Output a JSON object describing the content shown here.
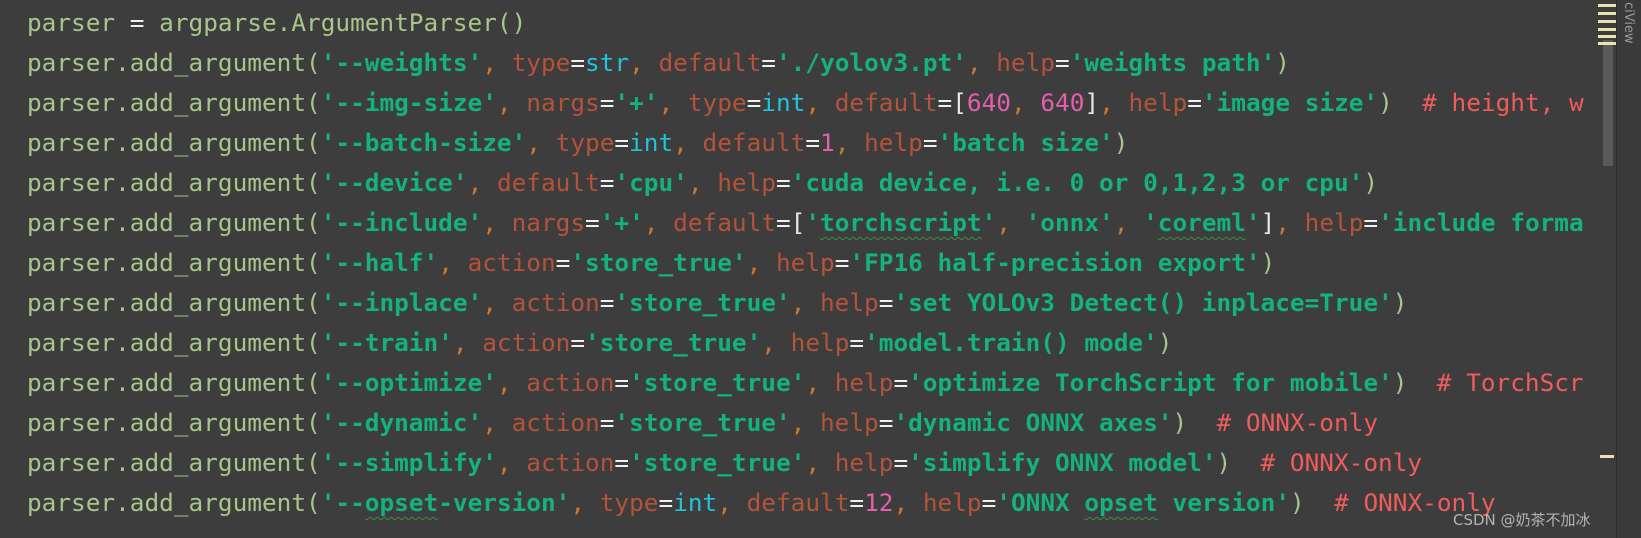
{
  "colors": {
    "background": "#3d3d3d",
    "default": "#a8c68a",
    "string": "#13b27f",
    "keyword_arg": "#b5533a",
    "builtin": "#22c3dc",
    "number": "#e35fb0",
    "comment": "#f05c5c"
  },
  "side_panel": {
    "label": "ciView"
  },
  "watermark": "CSDN @奶茶不加冰",
  "code_lines": [
    [
      [
        "def",
        "parser "
      ],
      [
        "eq",
        "="
      ],
      [
        "def",
        " argparse.ArgumentParser()"
      ]
    ],
    [
      [
        "def",
        "parser.add_argument("
      ],
      [
        "str",
        "'--weights'"
      ],
      [
        "com",
        ", "
      ],
      [
        "kw",
        "type"
      ],
      [
        "eq",
        "="
      ],
      [
        "bi",
        "str"
      ],
      [
        "com",
        ", "
      ],
      [
        "kw",
        "default"
      ],
      [
        "eq",
        "="
      ],
      [
        "str",
        "'./yolov3.pt'"
      ],
      [
        "com",
        ", "
      ],
      [
        "kw",
        "help"
      ],
      [
        "eq",
        "="
      ],
      [
        "str",
        "'weights path'"
      ],
      [
        "def",
        ")"
      ]
    ],
    [
      [
        "def",
        "parser.add_argument("
      ],
      [
        "str",
        "'--img-size'"
      ],
      [
        "com",
        ", "
      ],
      [
        "kw",
        "nargs"
      ],
      [
        "eq",
        "="
      ],
      [
        "str",
        "'+'"
      ],
      [
        "com",
        ", "
      ],
      [
        "kw",
        "type"
      ],
      [
        "eq",
        "="
      ],
      [
        "bi",
        "int"
      ],
      [
        "com",
        ", "
      ],
      [
        "kw",
        "default"
      ],
      [
        "eq",
        "="
      ],
      [
        "brk",
        "["
      ],
      [
        "num",
        "640"
      ],
      [
        "com",
        ", "
      ],
      [
        "num",
        "640"
      ],
      [
        "brk",
        "]"
      ],
      [
        "com",
        ", "
      ],
      [
        "kw",
        "help"
      ],
      [
        "eq",
        "="
      ],
      [
        "str",
        "'image size'"
      ],
      [
        "def",
        ")"
      ],
      [
        "cmt",
        "  # height, w"
      ]
    ],
    [
      [
        "def",
        "parser.add_argument("
      ],
      [
        "str",
        "'--batch-size'"
      ],
      [
        "com",
        ", "
      ],
      [
        "kw",
        "type"
      ],
      [
        "eq",
        "="
      ],
      [
        "bi",
        "int"
      ],
      [
        "com",
        ", "
      ],
      [
        "kw",
        "default"
      ],
      [
        "eq",
        "="
      ],
      [
        "num",
        "1"
      ],
      [
        "com",
        ", "
      ],
      [
        "kw",
        "help"
      ],
      [
        "eq",
        "="
      ],
      [
        "str",
        "'batch size'"
      ],
      [
        "def",
        ")"
      ]
    ],
    [
      [
        "def",
        "parser.add_argument("
      ],
      [
        "str",
        "'--device'"
      ],
      [
        "com",
        ", "
      ],
      [
        "kw",
        "default"
      ],
      [
        "eq",
        "="
      ],
      [
        "str",
        "'cpu'"
      ],
      [
        "com",
        ", "
      ],
      [
        "kw",
        "help"
      ],
      [
        "eq",
        "="
      ],
      [
        "str",
        "'cuda device, i.e. 0 or 0,1,2,3 or cpu'"
      ],
      [
        "def",
        ")"
      ]
    ],
    [
      [
        "def",
        "parser.add_argument("
      ],
      [
        "str",
        "'--include'"
      ],
      [
        "com",
        ", "
      ],
      [
        "kw",
        "nargs"
      ],
      [
        "eq",
        "="
      ],
      [
        "str",
        "'+'"
      ],
      [
        "com",
        ", "
      ],
      [
        "kw",
        "default"
      ],
      [
        "eq",
        "="
      ],
      [
        "brk",
        "["
      ],
      [
        "str",
        "'"
      ],
      [
        "sq",
        "torchscript"
      ],
      [
        "str",
        "'"
      ],
      [
        "com",
        ", "
      ],
      [
        "str",
        "'onnx'"
      ],
      [
        "com",
        ", "
      ],
      [
        "str",
        "'"
      ],
      [
        "sq",
        "coreml"
      ],
      [
        "str",
        "'"
      ],
      [
        "brk",
        "]"
      ],
      [
        "com",
        ", "
      ],
      [
        "kw",
        "help"
      ],
      [
        "eq",
        "="
      ],
      [
        "str",
        "'include forma"
      ]
    ],
    [
      [
        "def",
        "parser.add_argument("
      ],
      [
        "str",
        "'--half'"
      ],
      [
        "com",
        ", "
      ],
      [
        "kw",
        "action"
      ],
      [
        "eq",
        "="
      ],
      [
        "str",
        "'store_true'"
      ],
      [
        "com",
        ", "
      ],
      [
        "kw",
        "help"
      ],
      [
        "eq",
        "="
      ],
      [
        "str",
        "'FP16 half-precision export'"
      ],
      [
        "def",
        ")"
      ]
    ],
    [
      [
        "def",
        "parser.add_argument("
      ],
      [
        "str",
        "'--inplace'"
      ],
      [
        "com",
        ", "
      ],
      [
        "kw",
        "action"
      ],
      [
        "eq",
        "="
      ],
      [
        "str",
        "'store_true'"
      ],
      [
        "com",
        ", "
      ],
      [
        "kw",
        "help"
      ],
      [
        "eq",
        "="
      ],
      [
        "str",
        "'set YOLOv3 Detect() inplace=True'"
      ],
      [
        "def",
        ")"
      ]
    ],
    [
      [
        "def",
        "parser.add_argument("
      ],
      [
        "str",
        "'--train'"
      ],
      [
        "com",
        ", "
      ],
      [
        "kw",
        "action"
      ],
      [
        "eq",
        "="
      ],
      [
        "str",
        "'store_true'"
      ],
      [
        "com",
        ", "
      ],
      [
        "kw",
        "help"
      ],
      [
        "eq",
        "="
      ],
      [
        "str",
        "'model.train() mode'"
      ],
      [
        "def",
        ")"
      ]
    ],
    [
      [
        "def",
        "parser.add_argument("
      ],
      [
        "str",
        "'--optimize'"
      ],
      [
        "com",
        ", "
      ],
      [
        "kw",
        "action"
      ],
      [
        "eq",
        "="
      ],
      [
        "str",
        "'store_true'"
      ],
      [
        "com",
        ", "
      ],
      [
        "kw",
        "help"
      ],
      [
        "eq",
        "="
      ],
      [
        "str",
        "'optimize TorchScript for mobile'"
      ],
      [
        "def",
        ")"
      ],
      [
        "cmt",
        "  # TorchScr"
      ]
    ],
    [
      [
        "def",
        "parser.add_argument("
      ],
      [
        "str",
        "'--dynamic'"
      ],
      [
        "com",
        ", "
      ],
      [
        "kw",
        "action"
      ],
      [
        "eq",
        "="
      ],
      [
        "str",
        "'store_true'"
      ],
      [
        "com",
        ", "
      ],
      [
        "kw",
        "help"
      ],
      [
        "eq",
        "="
      ],
      [
        "str",
        "'dynamic ONNX axes'"
      ],
      [
        "def",
        ")"
      ],
      [
        "cmt",
        "  # ONNX-only"
      ]
    ],
    [
      [
        "def",
        "parser.add_argument("
      ],
      [
        "str",
        "'--simplify'"
      ],
      [
        "com",
        ", "
      ],
      [
        "kw",
        "action"
      ],
      [
        "eq",
        "="
      ],
      [
        "str",
        "'store_true'"
      ],
      [
        "com",
        ", "
      ],
      [
        "kw",
        "help"
      ],
      [
        "eq",
        "="
      ],
      [
        "str",
        "'simplify ONNX model'"
      ],
      [
        "def",
        ")"
      ],
      [
        "cmt",
        "  # ONNX-only"
      ]
    ],
    [
      [
        "def",
        "parser.add_argument("
      ],
      [
        "str",
        "'--"
      ],
      [
        "sq",
        "opset"
      ],
      [
        "str",
        "-version'"
      ],
      [
        "com",
        ", "
      ],
      [
        "kw",
        "type"
      ],
      [
        "eq",
        "="
      ],
      [
        "bi",
        "int"
      ],
      [
        "com",
        ", "
      ],
      [
        "kw",
        "default"
      ],
      [
        "eq",
        "="
      ],
      [
        "num",
        "12"
      ],
      [
        "com",
        ", "
      ],
      [
        "kw",
        "help"
      ],
      [
        "eq",
        "="
      ],
      [
        "str",
        "'ONNX "
      ],
      [
        "sq",
        "opset"
      ],
      [
        "str",
        " version'"
      ],
      [
        "def",
        ")"
      ],
      [
        "cmt",
        "  # ONNX-only"
      ]
    ]
  ]
}
